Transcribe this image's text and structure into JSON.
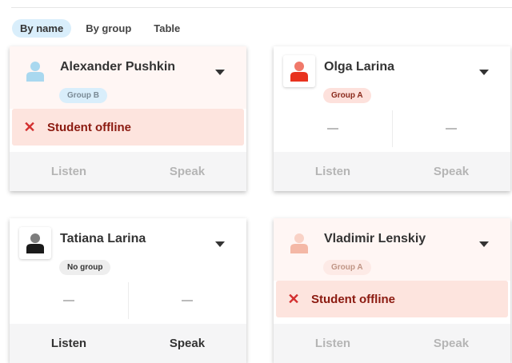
{
  "tabs": [
    {
      "label": "By name",
      "active": true
    },
    {
      "label": "By group",
      "active": false
    },
    {
      "label": "Table",
      "active": false
    }
  ],
  "colors": {
    "accent_tab": "#d9eefb",
    "offline_bg": "#fde4de",
    "offline_text": "#8b1a10"
  },
  "students": [
    {
      "name": "Alexander Pushkin",
      "group": "Group B",
      "status": "Student offline",
      "listen": "Listen",
      "speak": "Speak",
      "avatar_color": "#a9d8ef"
    },
    {
      "name": "Olga Larina",
      "group": "Group A",
      "level_left": "—",
      "level_right": "—",
      "listen": "Listen",
      "speak": "Speak",
      "avatar_color": "#e8321e"
    },
    {
      "name": "Tatiana Larina",
      "group": "No group",
      "level_left": "—",
      "level_right": "—",
      "listen": "Listen",
      "speak": "Speak",
      "avatar_color": "#1a1a1a"
    },
    {
      "name": "Vladimir Lenskiy",
      "group": "Group A",
      "status": "Student offline",
      "listen": "Listen",
      "speak": "Speak",
      "avatar_color": "#f4b8a6"
    }
  ]
}
